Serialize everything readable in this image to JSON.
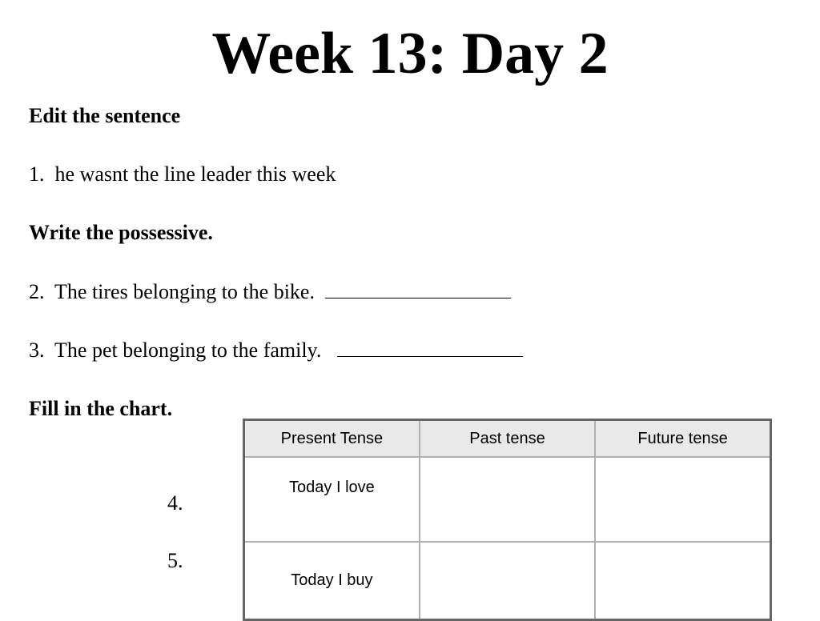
{
  "title": "Week 13: Day 2",
  "sections": [
    {
      "heading": "Edit the sentence",
      "items": [
        {
          "number": "1.",
          "text": "he wasnt the line leader this week"
        }
      ]
    },
    {
      "heading": "Write the possessive.",
      "items": [
        {
          "number": "2.",
          "text": "The tires belonging to the bike.",
          "answer": ""
        },
        {
          "number": "3.",
          "text": "The pet belonging to the family.",
          "answer": ""
        }
      ]
    },
    {
      "heading": "Fill in the chart.",
      "table": {
        "headers": [
          "Present Tense",
          "Past tense",
          "Future tense"
        ],
        "rows": [
          {
            "number": "4.",
            "cells": [
              "Today I love",
              "",
              ""
            ]
          },
          {
            "number": "5.",
            "cells": [
              "Today I buy",
              "",
              ""
            ]
          }
        ]
      }
    }
  ]
}
